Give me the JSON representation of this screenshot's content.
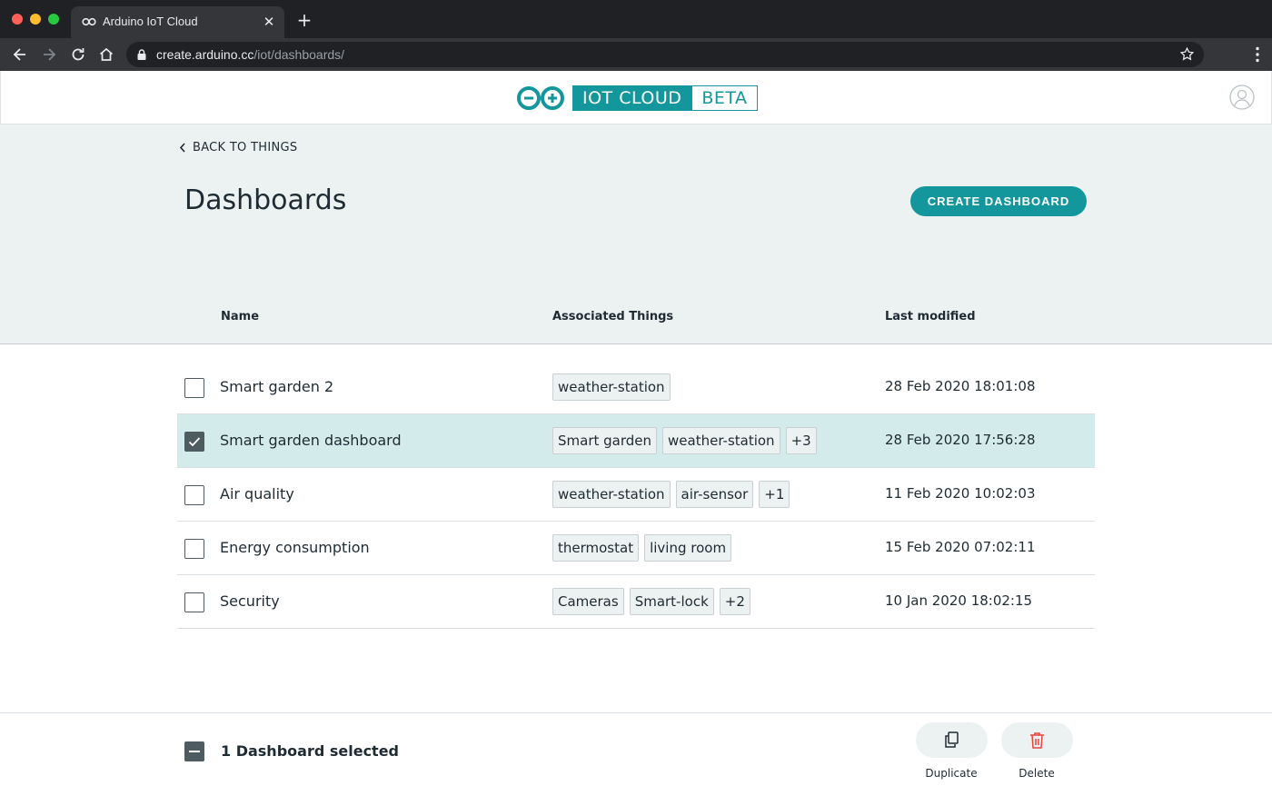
{
  "browser": {
    "tab_title": "Arduino IoT Cloud",
    "url_host": "create.arduino.cc",
    "url_path": "/iot/dashboards/"
  },
  "header": {
    "logo_main": "IOT CLOUD",
    "logo_badge": "BETA"
  },
  "page": {
    "back_label": "BACK TO THINGS",
    "title": "Dashboards",
    "create_button": "CREATE DASHBOARD"
  },
  "table": {
    "columns": [
      "Name",
      "Associated Things",
      "Last modified"
    ],
    "rows": [
      {
        "name": "Smart garden 2",
        "things": [
          "weather-station"
        ],
        "modified": "28 Feb 2020 18:01:08",
        "checked": false
      },
      {
        "name": "Smart garden dashboard",
        "things": [
          "Smart garden",
          "weather-station",
          "+3"
        ],
        "modified": "28 Feb 2020 17:56:28",
        "checked": true
      },
      {
        "name": "Air quality",
        "things": [
          "weather-station",
          "air-sensor",
          "+1"
        ],
        "modified": "11 Feb 2020 10:02:03",
        "checked": false
      },
      {
        "name": "Energy consumption",
        "things": [
          "thermostat",
          "living room"
        ],
        "modified": "15 Feb 2020 07:02:11",
        "checked": false
      },
      {
        "name": "Security",
        "things": [
          "Cameras",
          "Smart-lock",
          "+2"
        ],
        "modified": "10 Jan 2020 18:02:15",
        "checked": false
      }
    ]
  },
  "footer": {
    "selection_text": "1 Dashboard selected",
    "duplicate_label": "Duplicate",
    "delete_label": "Delete"
  },
  "colors": {
    "accent": "#13979c",
    "selected_row": "#d4ebec",
    "band": "#ecf1f1",
    "delete_icon": "#e0463c"
  }
}
